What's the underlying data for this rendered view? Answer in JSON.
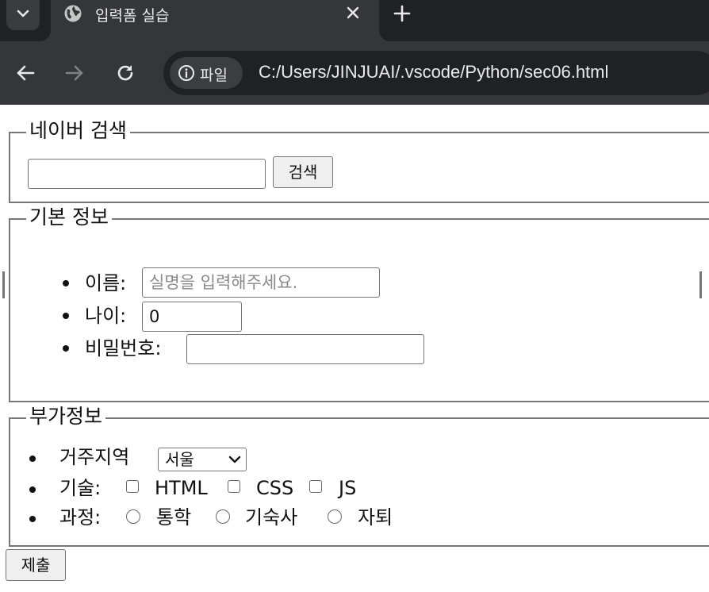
{
  "browser": {
    "tab_title": "입력폼 실습",
    "site_chip_label": "파일",
    "url": "C:/Users/JINJUAI/.vscode/Python/sec06.html",
    "icons": [
      "chevron-down-icon",
      "globe-icon",
      "close-icon",
      "plus-icon",
      "back-arrow-icon",
      "forward-arrow-icon",
      "reload-icon",
      "info-icon"
    ]
  },
  "naver_search": {
    "legend": "네이버 검색",
    "input_value": "",
    "button_label": "검색"
  },
  "basic_info": {
    "legend": "기본 정보",
    "name_label": "이름:",
    "name_placeholder": "실명을 입력해주세요.",
    "age_label": "나이:",
    "age_value": "0",
    "password_label": "비밀번호:",
    "password_value": ""
  },
  "extra_info": {
    "legend": "부가정보",
    "region_label": "거주지역",
    "region_selected": "서울",
    "skills_label": "기술:",
    "skills": [
      "HTML",
      "CSS",
      "JS"
    ],
    "course_label": "과정:",
    "courses": [
      "통학",
      "기숙사",
      "자퇴"
    ]
  },
  "submit_label": "제출"
}
